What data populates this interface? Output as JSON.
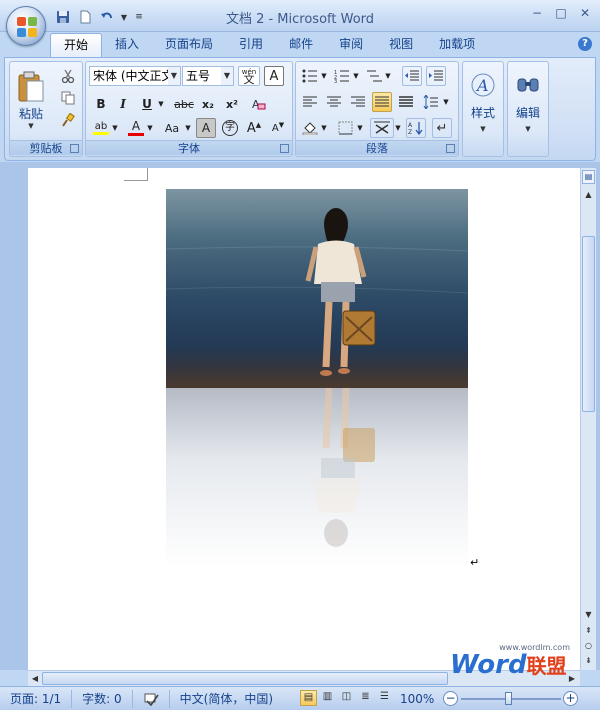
{
  "window": {
    "title": "文档 2 - Microsoft Word",
    "minimize": "−",
    "maximize": "□",
    "close": "✕"
  },
  "tabs": [
    {
      "label": "开始"
    },
    {
      "label": "插入"
    },
    {
      "label": "页面布局"
    },
    {
      "label": "引用"
    },
    {
      "label": "邮件"
    },
    {
      "label": "审阅"
    },
    {
      "label": "视图"
    },
    {
      "label": "加载项"
    }
  ],
  "help_label": "?",
  "ribbon": {
    "clipboard": {
      "label": "剪贴板",
      "paste_label": "粘贴"
    },
    "font": {
      "label": "字体",
      "font_name": "宋体 (中文正文)",
      "font_size": "五号",
      "bold": "B",
      "italic": "I",
      "underline": "U",
      "strike": "abc",
      "subscript": "x₂",
      "superscript": "x²",
      "change_case": "Aa",
      "char_shading": "A",
      "enclose": "字",
      "grow": "A",
      "shrink": "A",
      "clear": "A",
      "phonetic": "wén"
    },
    "paragraph": {
      "label": "段落"
    },
    "styles": {
      "label": "样式"
    },
    "editing": {
      "label": "编辑"
    }
  },
  "status": {
    "page": "页面: 1/1",
    "words": "字数: 0",
    "language": "中文(简体，中国)",
    "zoom": "100%"
  },
  "watermark": {
    "word": "Word",
    "cn": "联盟",
    "url": "www.wordlm.com"
  },
  "colors": {
    "accent": "#15428b",
    "font_color_bar": "#e60000",
    "highlight_bar": "#ffff00"
  }
}
